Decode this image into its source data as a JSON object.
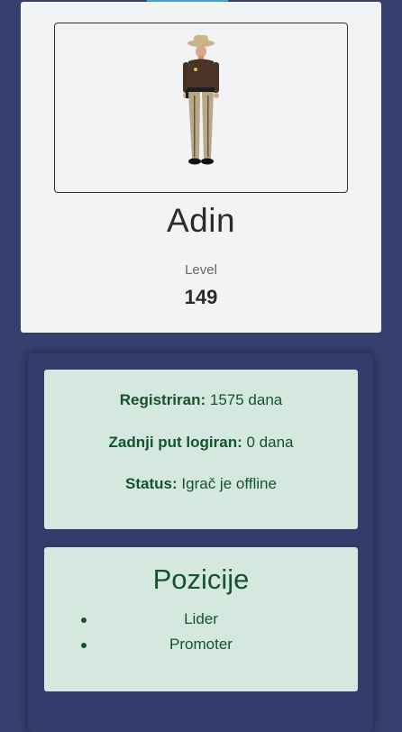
{
  "profile": {
    "name": "Adin",
    "level_label": "Level",
    "level": "149",
    "avatar_icon": "police-officer-character"
  },
  "stats": {
    "registered_label": "Registriran:",
    "registered_value": "1575 dana",
    "last_login_label": "Zadnji put logiran:",
    "last_login_value": "0 dana",
    "status_label": "Status:",
    "status_value": "Igrač je offline"
  },
  "positions": {
    "title": "Pozicije",
    "items": [
      "Lider",
      "Promoter"
    ]
  },
  "colors": {
    "background": "#363f6e",
    "card": "#f2f3f5",
    "stat_box": "#d4e8df",
    "stat_text": "#14532d",
    "accent": "#3fa3dc"
  }
}
